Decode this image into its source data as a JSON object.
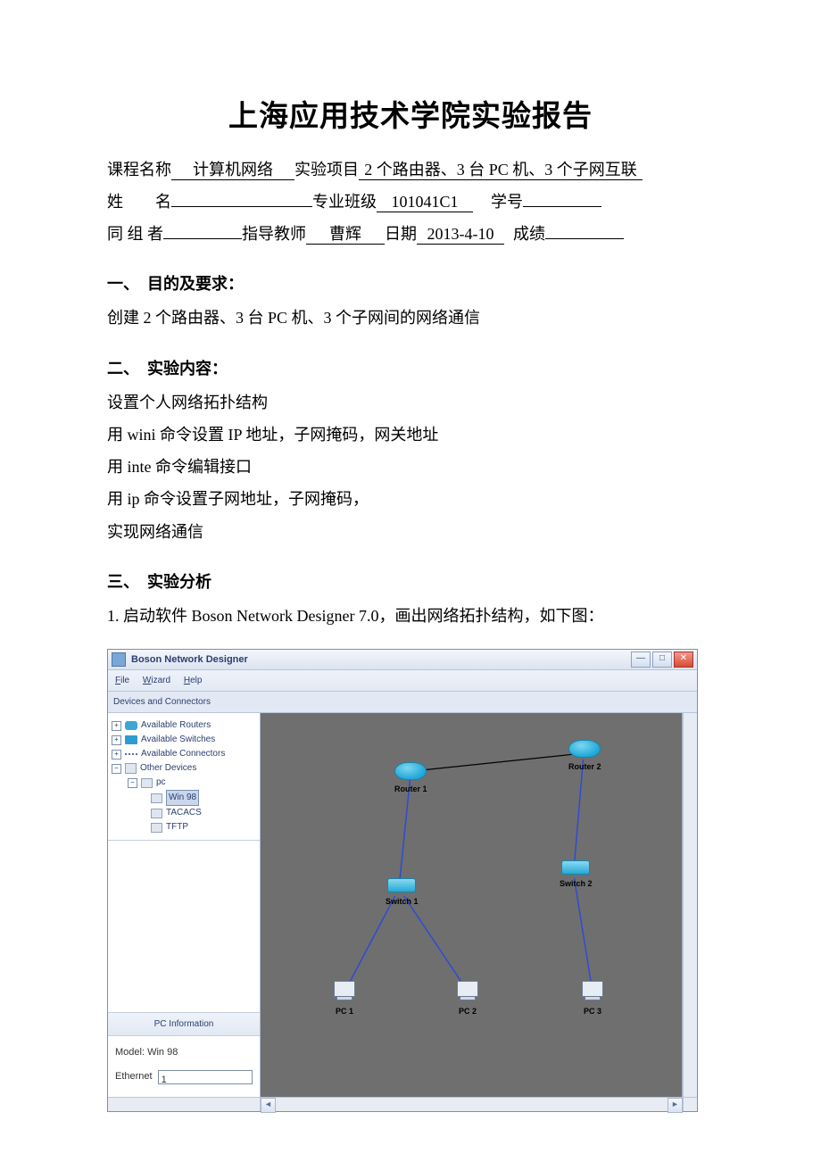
{
  "doc": {
    "title": "上海应用技术学院实验报告",
    "meta": {
      "course_label": "课程名称",
      "course_value": "计算机网络",
      "project_label": "实验项目",
      "project_value": "2 个路由器、3 台 PC 机、3 个子网互联",
      "name_label": "姓　　名",
      "name_value": "",
      "class_label": "专业班级",
      "class_value": "101041C1",
      "id_label": "学号",
      "id_value": "",
      "partner_label": "同 组 者",
      "partner_value": "",
      "teacher_label": "指导教师",
      "teacher_value": "曹辉",
      "date_label": "日期",
      "date_value": "2013-4-10",
      "score_label": "成绩",
      "score_value": ""
    },
    "s1_head": "一、　目的及要求：",
    "s1_p1": "创建 2 个路由器、3 台 PC 机、3 个子网间的网络通信",
    "s2_head": "二、　实验内容：",
    "s2_p1": "设置个人网络拓扑结构",
    "s2_p2": "用 wini 命令设置 IP 地址，子网掩码，网关地址",
    "s2_p3": "用 inte 命令编辑接口",
    "s2_p4": "用 ip 命令设置子网地址，子网掩码，",
    "s2_p5": "实现网络通信",
    "s3_head": "三、　实验分析",
    "s3_p1": "1. 启动软件 Boson Network Designer 7.0，画出网络拓扑结构，如下图："
  },
  "app": {
    "title": "Boson Network Designer",
    "menu": {
      "file": "File",
      "wizard": "Wizard",
      "help": "Help"
    },
    "devices_header": "Devices and Connectors",
    "tree": {
      "routers": "Available Routers",
      "switches": "Available Switches",
      "connectors": "Available Connectors",
      "other": "Other Devices",
      "pc": "pc",
      "win98": "Win 98",
      "tacacs": "TACACS",
      "tftp": "TFTP"
    },
    "info_header": "PC Information",
    "info_model_label": "Model:",
    "info_model_value": "Win 98",
    "info_eth_label": "Ethernet",
    "info_eth_value": "1",
    "nodes": {
      "router1": "Router 1",
      "router2": "Router 2",
      "switch1": "Switch 1",
      "switch2": "Switch 2",
      "pc1": "PC 1",
      "pc2": "PC 2",
      "pc3": "PC 3"
    }
  }
}
